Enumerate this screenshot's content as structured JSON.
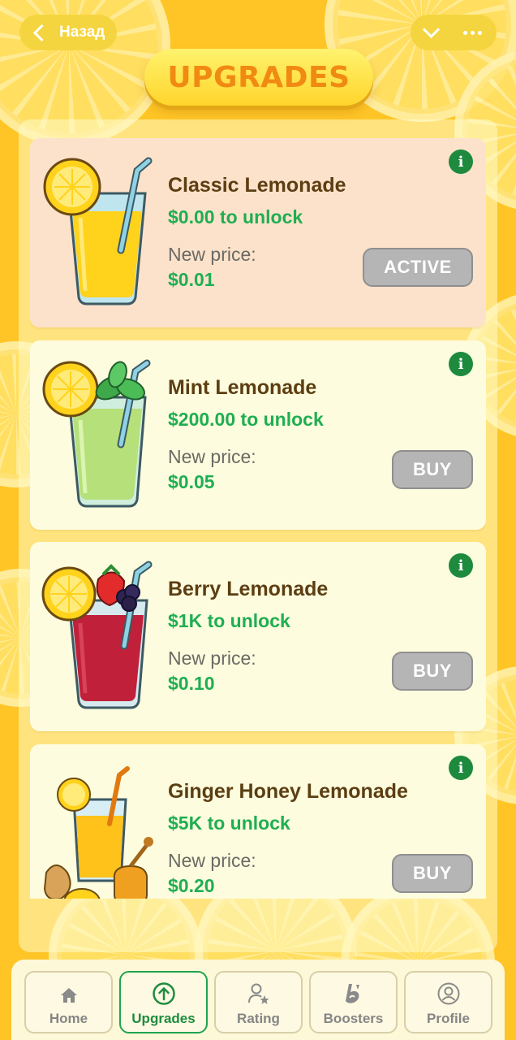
{
  "header": {
    "back_label": "Назад",
    "title": "UPGRADES"
  },
  "upgrades": [
    {
      "name": "Classic Lemonade",
      "unlock": "$0.00 to unlock",
      "new_price_label": "New price:",
      "new_price": "$0.01",
      "button": "ACTIVE",
      "state": "active",
      "icon": "classic-lemonade-icon"
    },
    {
      "name": "Mint Lemonade",
      "unlock": "$200.00 to unlock",
      "new_price_label": "New price:",
      "new_price": "$0.05",
      "button": "BUY",
      "state": "locked",
      "icon": "mint-lemonade-icon"
    },
    {
      "name": "Berry Lemonade",
      "unlock": "$1K to unlock",
      "new_price_label": "New price:",
      "new_price": "$0.10",
      "button": "BUY",
      "state": "locked",
      "icon": "berry-lemonade-icon"
    },
    {
      "name": "Ginger Honey Lemonade",
      "unlock": "$5K to unlock",
      "new_price_label": "New price:",
      "new_price": "$0.20",
      "button": "BUY",
      "state": "locked",
      "icon": "ginger-honey-lemonade-icon"
    }
  ],
  "nav": {
    "items": [
      {
        "label": "Home",
        "icon": "home-icon"
      },
      {
        "label": "Upgrades",
        "icon": "upgrade-arrow-icon",
        "selected": true
      },
      {
        "label": "Rating",
        "icon": "rating-icon"
      },
      {
        "label": "Boosters",
        "icon": "booster-icon"
      },
      {
        "label": "Profile",
        "icon": "profile-icon"
      }
    ]
  },
  "colors": {
    "background": "#ffc526",
    "accent_green": "#1fae52",
    "title_orange": "#f08a12",
    "active_card": "#fde2cb",
    "card": "#fdfcde",
    "button_gray": "#b5b5b5"
  }
}
